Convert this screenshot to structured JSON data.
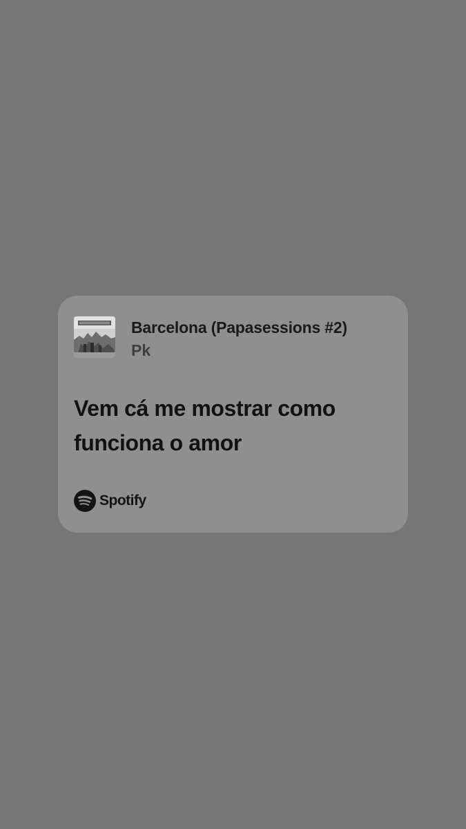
{
  "card": {
    "album_cover": {
      "icon": "album-cover-art",
      "lettering": "BARCELONA"
    },
    "track_title": "Barcelona (Papasessions #2)",
    "artist": "Pk",
    "lyrics": [
      "Vem cá me mostrar como",
      "funciona o amor"
    ],
    "brand": {
      "icon": "spotify-logo-icon",
      "name": "Spotify"
    }
  },
  "colors": {
    "background": "#767676",
    "card": "#8f8f8f",
    "text_primary": "#121212",
    "text_secondary": "#3f3f3f"
  }
}
